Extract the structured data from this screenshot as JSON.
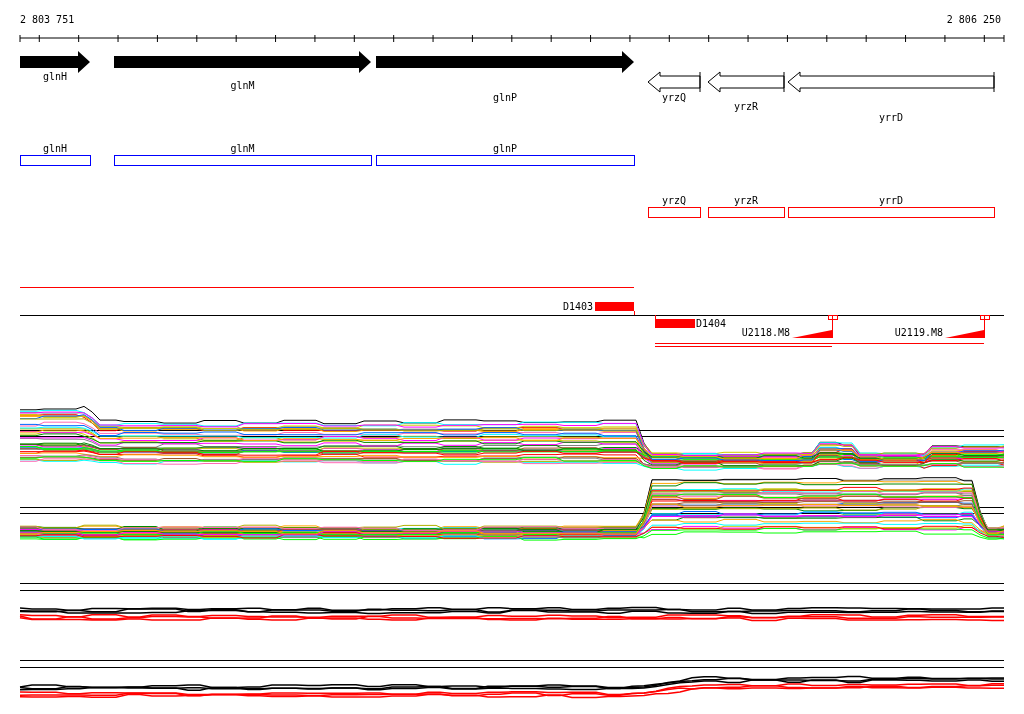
{
  "axis": {
    "start_label": "2 803 751",
    "end_label": "2 806 250"
  },
  "genes": [
    {
      "name": "glnH",
      "kind": "forward"
    },
    {
      "name": "glnM",
      "kind": "forward"
    },
    {
      "name": "glnP",
      "kind": "forward"
    },
    {
      "name": "yrzQ",
      "kind": "reverse"
    },
    {
      "name": "yrzR",
      "kind": "reverse"
    },
    {
      "name": "yrrD",
      "kind": "reverse"
    }
  ],
  "annotations": [
    {
      "name": "glnH",
      "color": "#0000ff"
    },
    {
      "name": "glnM",
      "color": "#0000ff"
    },
    {
      "name": "glnP",
      "color": "#0000ff"
    },
    {
      "name": "yrzQ",
      "color": "#ff0000"
    },
    {
      "name": "yrzR",
      "color": "#ff0000"
    },
    {
      "name": "yrrD",
      "color": "#ff0000"
    }
  ],
  "transcripts": [
    {
      "label": "D1403",
      "kind": "block"
    },
    {
      "label": "D1404",
      "kind": "block"
    },
    {
      "label": "U2118.M8",
      "kind": "ramp"
    },
    {
      "label": "U2119.M8",
      "kind": "ramp"
    }
  ]
}
